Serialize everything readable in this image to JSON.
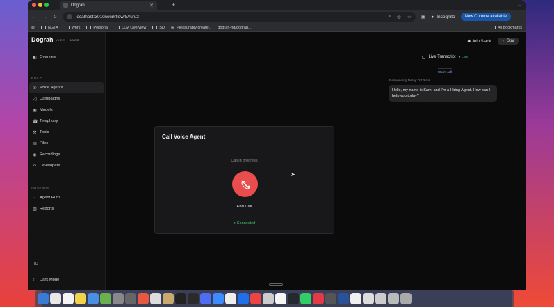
{
  "browser": {
    "tab_title": "Dograh",
    "url": "localhost:3010/workflow/8/run/2",
    "incognito_label": "Incognito",
    "new_chrome_label": "New Chrome available",
    "bookmarks": [
      "NGTA",
      "Work",
      "Personal",
      "LLM Overview",
      "SD",
      "Pleasurably create...",
      "dograh-hq/dograh..."
    ],
    "all_bookmarks_label": "All Bookmarks"
  },
  "sidebar": {
    "brand": "Dograh",
    "version": "v1.2.0",
    "latest": "Latest",
    "overview": "Overview",
    "build_section": "BUILD",
    "build_items": [
      "Voice Agents",
      "Campaigns",
      "Models",
      "Telephony",
      "Tools",
      "Files",
      "Recordings",
      "Developers"
    ],
    "observe_section": "OBSERVE",
    "observe_items": [
      "Agent Runs",
      "Reports"
    ],
    "user_initials": "TD",
    "dark_mode": "Dark Mode"
  },
  "topbar": {
    "join_slack": "Join Slack",
    "star": "Star"
  },
  "dialog": {
    "title": "Call Voice Agent",
    "status": "Call in progress",
    "end_call": "End Call",
    "connection": "Connected"
  },
  "transcript": {
    "title": "Live Transcript",
    "live_badge": "Live",
    "warm_call": "Warm call",
    "latency": "Responding Delay: 2426ms",
    "message": "Hello, my name is Sam, and I'm a Hiring Agent. How can I help you today?"
  },
  "colors": {
    "accent_red": "#ea4d4d",
    "live_green": "#3fbf6a",
    "chrome_blue": "#1a56a8"
  }
}
